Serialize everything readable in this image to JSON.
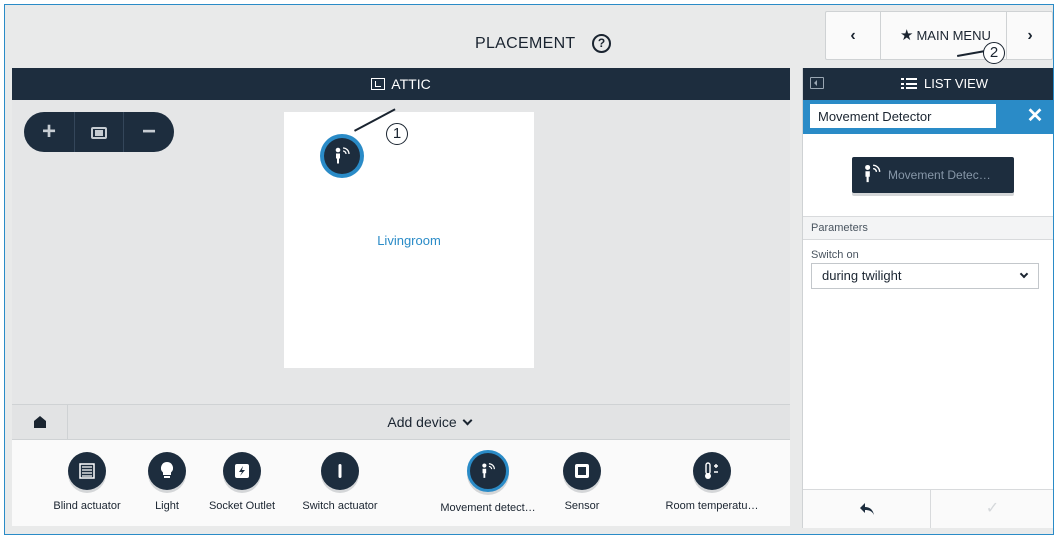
{
  "header": {
    "title": "PLACEMENT",
    "help_icon": "help-icon",
    "nav_prev": "‹",
    "main_menu_label": "MAIN MENU",
    "nav_next": "›"
  },
  "floor": {
    "label": "ATTIC",
    "icon": "floor-plan-icon"
  },
  "zoom": {
    "in": "+",
    "out": "−",
    "fit_icon": "fit-to-screen-icon"
  },
  "room": {
    "label": "Livingroom",
    "device_icon": "movement-detector-icon"
  },
  "callouts": [
    "1",
    "2"
  ],
  "add_device": {
    "label": "Add device",
    "home_icon": "house-icon"
  },
  "tray": {
    "items": [
      {
        "label": "Blind actuator",
        "icon": "blind-actuator-icon"
      },
      {
        "label": "Light",
        "icon": "light-bulb-icon"
      },
      {
        "label": "Socket Outlet",
        "icon": "socket-outlet-icon"
      },
      {
        "label": "Switch actuator",
        "icon": "switch-actuator-icon"
      },
      {
        "label": "Movement detect…",
        "icon": "movement-detector-icon",
        "active": true
      },
      {
        "label": "Sensor",
        "icon": "sensor-icon"
      },
      {
        "label": "Room temperatu…",
        "icon": "room-temperature-icon"
      }
    ]
  },
  "side_panel": {
    "list_view_label": "LIST VIEW",
    "name_value": "Movement Detector",
    "close_label": "✕",
    "device_tile_label": "Movement Detec…",
    "parameters_label": "Parameters",
    "switch_on_label": "Switch on",
    "switch_on_value": "during twilight",
    "confirm_label": "✓"
  },
  "colors": {
    "accent": "#2a8bc7",
    "dark": "#1d2d3e",
    "background": "#e9eaea"
  }
}
